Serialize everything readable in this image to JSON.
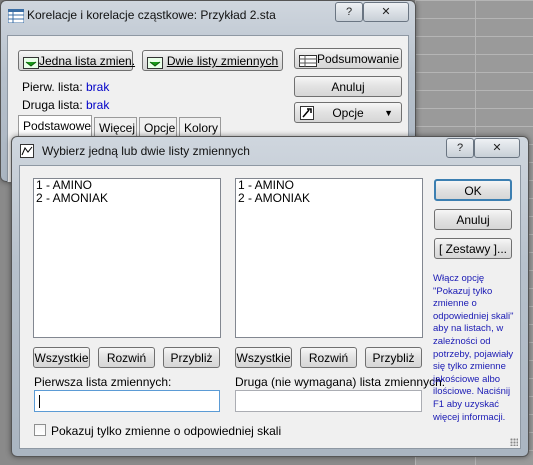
{
  "back_window": {
    "title": "Korelacje i korelacje cząstkowe: Przykład 2.sta",
    "help_btn": "?",
    "close_btn": "✕",
    "btn_one_list": "Jedna lista zmien.",
    "btn_two_lists": "Dwie listy zmiennych",
    "btn_summary": "Podsumowanie",
    "btn_cancel": "Anuluj",
    "btn_options": "Opcje",
    "first_list_label": "Pierw. lista:",
    "first_list_value": "brak",
    "second_list_label": "Druga lista:",
    "second_list_value": "brak",
    "tabs": [
      "Podstawowe",
      "Więcej",
      "Opcje",
      "Kolory"
    ]
  },
  "dialog": {
    "title": "Wybierz jedną lub dwie listy zmiennych",
    "help_btn": "?",
    "close_btn": "✕",
    "left_list": [
      "1 - AMINO",
      "2 - AMONIAK"
    ],
    "right_list": [
      "1 - AMINO",
      "2 - AMONIAK"
    ],
    "btn_all": "Wszystkie",
    "btn_expand": "Rozwiń",
    "btn_zoom": "Przybliż",
    "first_var_label": "Pierwsza lista zmiennych:",
    "second_var_label": "Druga (nie wymagana) lista zmiennych:",
    "first_var_value": "",
    "second_var_value": "",
    "checkbox_label": "Pokazuj tylko zmienne o odpowiedniej skali",
    "btn_ok": "OK",
    "btn_cancel": "Anuluj",
    "btn_sets": "[ Zestawy ]...",
    "hint": "Włącz opcję \"Pokazuj tylko zmienne o odpowiedniej skali\" aby na listach, w zależności od potrzeby, pojawiały się tylko zmienne jakościowe albo ilościowe. Naciśnij F1 aby uzyskać więcej informacji."
  }
}
